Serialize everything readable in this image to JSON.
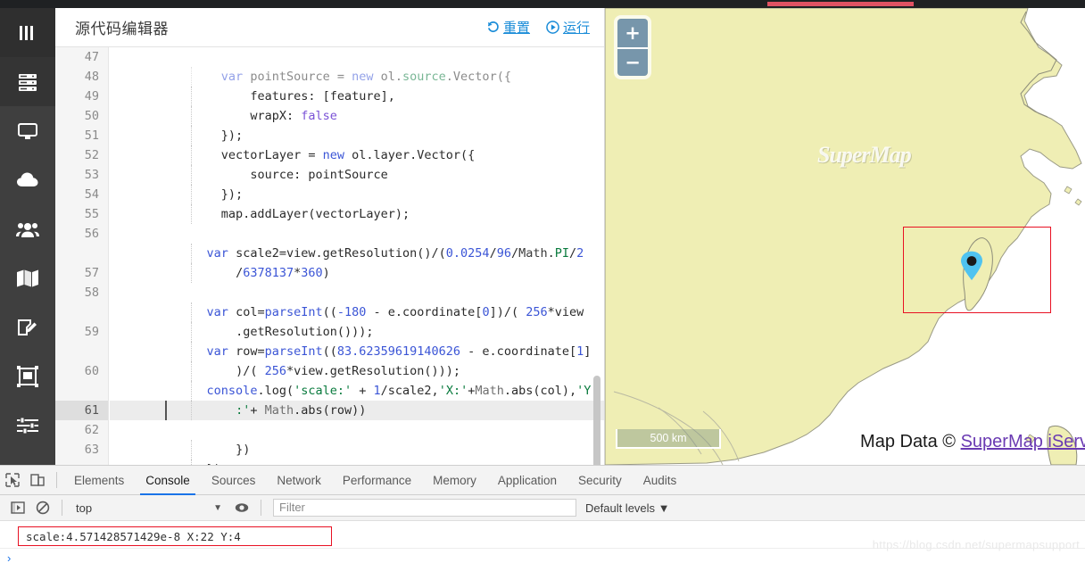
{
  "topbar": {
    "progress_color": "#e05263"
  },
  "sidebar": {
    "items": [
      {
        "icon": "menu-bars-icon",
        "name": "sidebar-item-menu"
      },
      {
        "icon": "server-icon",
        "name": "sidebar-item-server"
      },
      {
        "icon": "monitor-icon",
        "name": "sidebar-item-monitor"
      },
      {
        "icon": "cloud-icon",
        "name": "sidebar-item-cloud"
      },
      {
        "icon": "users-icon",
        "name": "sidebar-item-users"
      },
      {
        "icon": "map-icon",
        "name": "sidebar-item-map"
      },
      {
        "icon": "edit-icon",
        "name": "sidebar-item-edit"
      },
      {
        "icon": "layout-icon",
        "name": "sidebar-item-layout"
      },
      {
        "icon": "sliders-icon",
        "name": "sidebar-item-settings"
      },
      {
        "icon": "dashboard-icon",
        "name": "sidebar-item-dashboard"
      }
    ]
  },
  "editor": {
    "title": "源代码编辑器",
    "reset_label": "重置",
    "run_label": "运行",
    "reset_icon": "undo-icon",
    "run_icon": "play-circle-icon",
    "accent": "#1a8cd8",
    "current_line": 61,
    "lines": [
      {
        "n": 47,
        "text": "var pointSource = new ol.source.Vector({"
      },
      {
        "n": 48,
        "text": "        features: [feature],"
      },
      {
        "n": 49,
        "text": "        wrapX: false"
      },
      {
        "n": 50,
        "text": "    });"
      },
      {
        "n": 51,
        "text": "    vectorLayer = new ol.layer.Vector({"
      },
      {
        "n": 52,
        "text": "        source: pointSource"
      },
      {
        "n": 53,
        "text": "    });"
      },
      {
        "n": 54,
        "text": "    map.addLayer(vectorLayer);"
      },
      {
        "n": 55,
        "text": ""
      },
      {
        "n": 56,
        "text": "  var scale2=view.getResolution()/(0.0254/96/Math.PI/2"
      },
      {
        "n": 56,
        "text": "      /6378137*360)"
      },
      {
        "n": 57,
        "text": ""
      },
      {
        "n": 58,
        "text": "  var col=parseInt((-180 - e.coordinate[0])/( 256*view"
      },
      {
        "n": 58,
        "text": "      .getResolution()));"
      },
      {
        "n": 59,
        "text": "  var row=parseInt((83.62359619140626 - e.coordinate[1]"
      },
      {
        "n": 59,
        "text": "      )/( 256*view.getResolution()));"
      },
      {
        "n": 60,
        "text": "  console.log('scale:' + 1/scale2,'X:'+Math.abs(col),'Y"
      },
      {
        "n": 60,
        "text": "      :'+ Math.abs(row))"
      },
      {
        "n": 61,
        "text": ""
      },
      {
        "n": 62,
        "text": "      })"
      },
      {
        "n": 63,
        "text": "  });"
      }
    ]
  },
  "map": {
    "zoom_in_label": "+",
    "zoom_out_label": "−",
    "watermark": "SuperMap",
    "scale_label": "500 km",
    "attribution_prefix": "Map Data © ",
    "attribution_link": "SuperMap iServ",
    "marker": "map-pin-marker",
    "land_color": "#efeeb4",
    "highlight_box_color": "#e81123",
    "pin_color": "#4fc3f0"
  },
  "devtools": {
    "inspect_icon": "inspect-cursor-icon",
    "device_icon": "device-toolbar-icon",
    "tabs": [
      {
        "label": "Elements",
        "active": false
      },
      {
        "label": "Console",
        "active": true
      },
      {
        "label": "Sources",
        "active": false
      },
      {
        "label": "Network",
        "active": false
      },
      {
        "label": "Performance",
        "active": false
      },
      {
        "label": "Memory",
        "active": false
      },
      {
        "label": "Application",
        "active": false
      },
      {
        "label": "Security",
        "active": false
      },
      {
        "label": "Audits",
        "active": false
      }
    ],
    "sidebar_toggle_icon": "console-sidebar-icon",
    "clear_icon": "clear-console-icon",
    "eye_icon": "eye-live-expression-icon",
    "context": "top",
    "filter_placeholder": "Filter",
    "levels_label": "Default levels",
    "console_message": "scale:4.571428571429e-8 X:22 Y:4",
    "prompt": "›"
  },
  "watermark_footer": "https://blog.csdn.net/supermapsupport"
}
